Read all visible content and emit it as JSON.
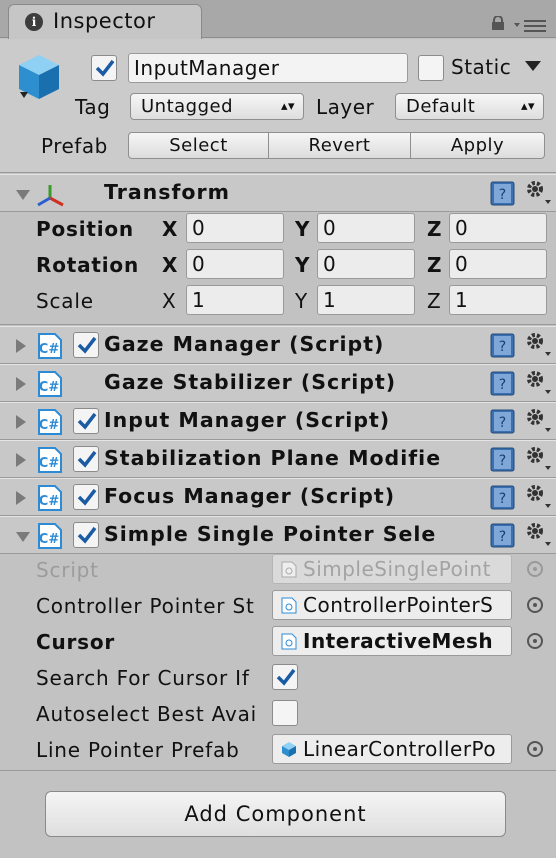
{
  "tab": {
    "title": "Inspector"
  },
  "header": {
    "object_name": "InputManager",
    "active_checked": true,
    "static_label": "Static",
    "static_checked": false,
    "tag_label": "Tag",
    "tag_value": "Untagged",
    "layer_label": "Layer",
    "layer_value": "Default",
    "prefab_label": "Prefab",
    "prefab_buttons": [
      "Select",
      "Revert",
      "Apply"
    ]
  },
  "transform": {
    "title": "Transform",
    "rows": [
      {
        "label": "Position",
        "x": "0",
        "y": "0",
        "z": "0",
        "bold": true
      },
      {
        "label": "Rotation",
        "x": "0",
        "y": "0",
        "z": "0",
        "bold": true
      },
      {
        "label": "Scale",
        "x": "1",
        "y": "1",
        "z": "1",
        "bold": false
      }
    ],
    "axes": [
      "X",
      "Y",
      "Z"
    ]
  },
  "components": [
    {
      "title": "Gaze Manager (Script)",
      "enabled": true
    },
    {
      "title": "Gaze Stabilizer (Script)",
      "enabled": null
    },
    {
      "title": "Input Manager (Script)",
      "enabled": true
    },
    {
      "title": "Stabilization Plane Modifie",
      "enabled": true
    },
    {
      "title": "Focus Manager (Script)",
      "enabled": true
    },
    {
      "title": "Simple Single Pointer Sele",
      "enabled": true
    }
  ],
  "pointer_fields": {
    "script_label": "Script",
    "script_value": "SimpleSinglePoint",
    "controller_label": "Controller Pointer St",
    "controller_value": "ControllerPointerS",
    "cursor_label": "Cursor",
    "cursor_value": "InteractiveMesh",
    "search_label": "Search For Cursor If",
    "search_checked": true,
    "autoselect_label": "Autoselect Best Avai",
    "autoselect_checked": false,
    "line_label": "Line Pointer Prefab",
    "line_value": "LinearControllerPo"
  },
  "add_component": "Add Component",
  "colors": {
    "panel": "#c2c2c2",
    "header": "#c8c8c8",
    "check": "#1a5ba3",
    "script_icon": "#2d8bd6"
  }
}
